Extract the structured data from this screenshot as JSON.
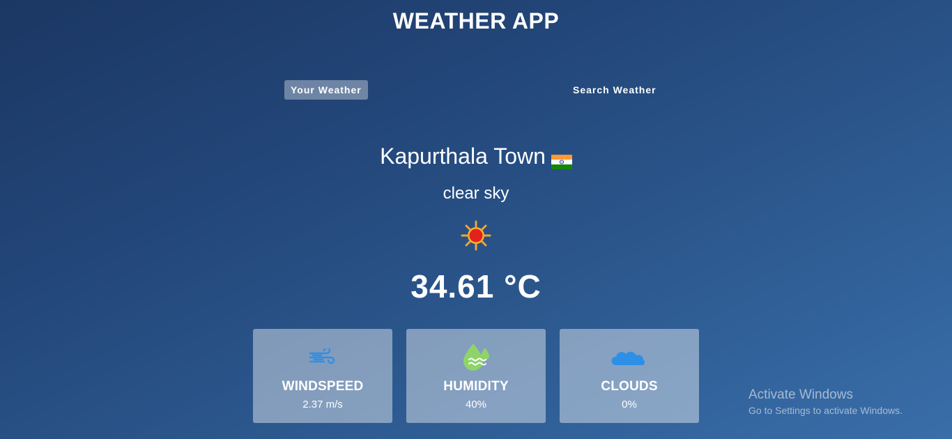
{
  "header": {
    "title": "WEATHER APP"
  },
  "tabs": [
    {
      "label": "Your Weather",
      "active": true
    },
    {
      "label": "Search Weather",
      "active": false
    }
  ],
  "weather": {
    "city": "Kapurthala Town",
    "country_flag_icon": "india-flag-icon",
    "description": "clear sky",
    "condition_icon": "sun-icon",
    "temperature": "34.61 °C"
  },
  "stats": [
    {
      "label": "WINDSPEED",
      "value": "2.37 m/s",
      "icon": "wind-icon"
    },
    {
      "label": "HUMIDITY",
      "value": "40%",
      "icon": "humidity-icon"
    },
    {
      "label": "CLOUDS",
      "value": "0%",
      "icon": "cloud-icon"
    }
  ],
  "watermark": {
    "title": "Activate Windows",
    "subtitle": "Go to Settings to activate Windows."
  },
  "colors": {
    "background_top": "#1b3763",
    "background_bottom": "#3a6ea9",
    "icon_blue": "#2e8fe6",
    "icon_green": "#8fd46a"
  }
}
